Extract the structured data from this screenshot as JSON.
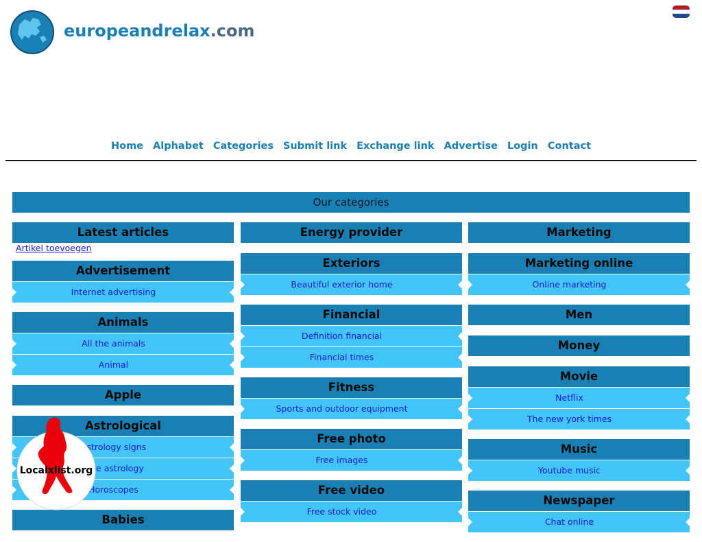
{
  "site": {
    "logo_text_main": "europeandrelax",
    "logo_text_tld": ".com",
    "flag": [
      "#ae1c28",
      "#ffffff",
      "#21468b"
    ]
  },
  "nav": [
    "Home",
    "Alphabet",
    "Categories",
    "Submit link",
    "Exchange link",
    "Advertise",
    "Login",
    "Contact"
  ],
  "categories_title": "Our categories",
  "columns": [
    [
      {
        "title": "Latest articles",
        "links": [],
        "plain_link": "Artikel toevoegen"
      },
      {
        "title": "Advertisement",
        "links": [
          "Internet advertising"
        ]
      },
      {
        "title": "Animals",
        "links": [
          "All the animals",
          "Animal"
        ]
      },
      {
        "title": "Apple",
        "links": []
      },
      {
        "title": "Astrological",
        "links": [
          "Astrology signs",
          "Free astrology",
          "Horoscopes"
        ]
      },
      {
        "title": "Babies",
        "links": []
      }
    ],
    [
      {
        "title": "Energy provider",
        "links": []
      },
      {
        "title": "Exteriors",
        "links": [
          "Beautiful exterior home"
        ]
      },
      {
        "title": "Financial",
        "links": [
          "Definition financial",
          "Financial times"
        ]
      },
      {
        "title": "Fitness",
        "links": [
          "Sports and outdoor equipment"
        ]
      },
      {
        "title": "Free photo",
        "links": [
          "Free images"
        ]
      },
      {
        "title": "Free video",
        "links": [
          "Free stock video"
        ]
      }
    ],
    [
      {
        "title": "Marketing",
        "links": []
      },
      {
        "title": "Marketing online",
        "links": [
          "Online marketing"
        ]
      },
      {
        "title": "Men",
        "links": []
      },
      {
        "title": "Money",
        "links": []
      },
      {
        "title": "Movie",
        "links": [
          "Netflix",
          "The new york times"
        ]
      },
      {
        "title": "Music",
        "links": [
          "Youtube music"
        ]
      },
      {
        "title": "Newspaper",
        "links": [
          "Chat online"
        ]
      }
    ]
  ],
  "badge": {
    "text": "Localxlist.org",
    "accent": "#e8000b"
  }
}
